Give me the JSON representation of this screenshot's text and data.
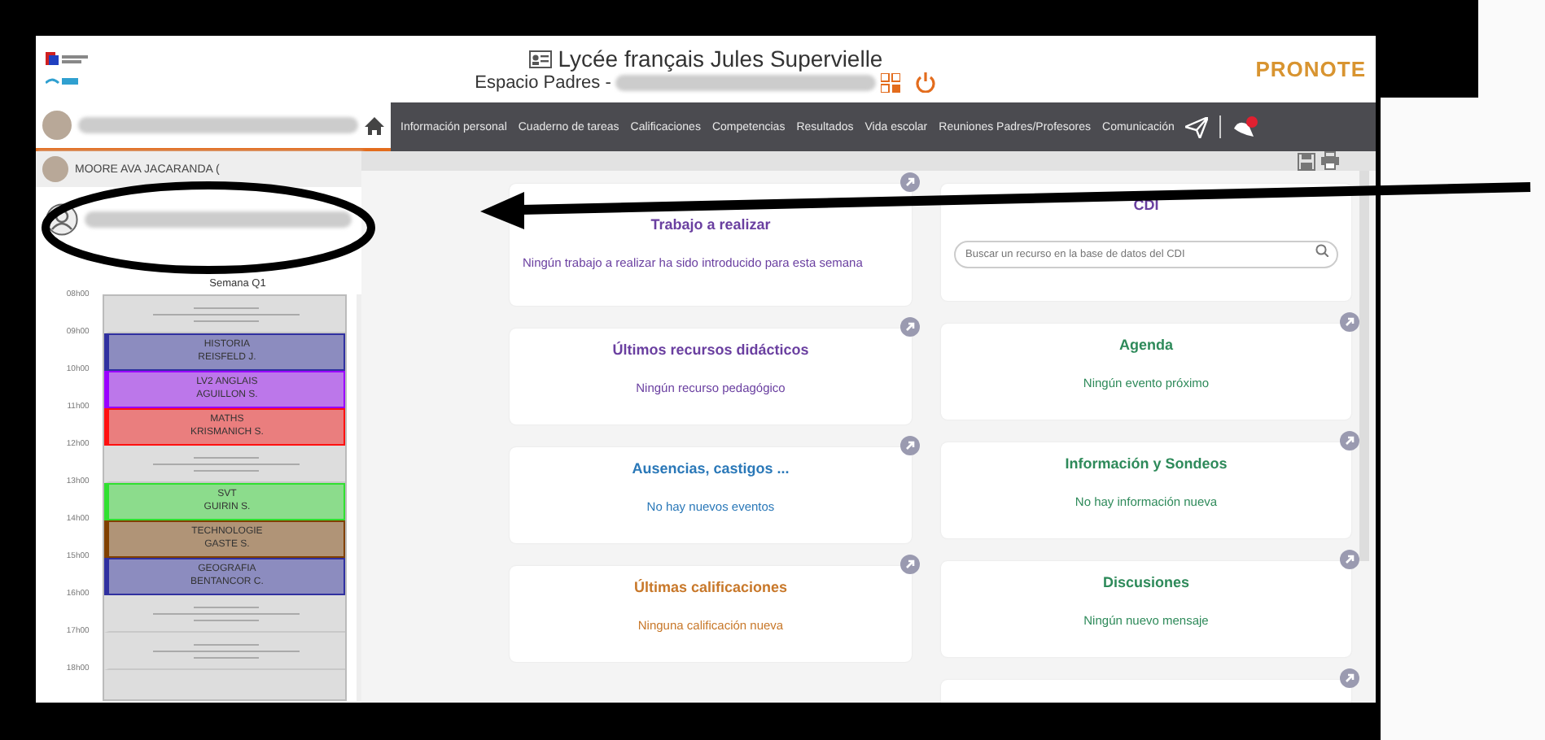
{
  "header": {
    "title": "Lycée français Jules Supervielle",
    "subtitle": "Espacio Padres -",
    "logo": "PRONOTE"
  },
  "nav": {
    "items": [
      {
        "label": "Información personal"
      },
      {
        "label": "Cuaderno de tareas"
      },
      {
        "label": "Calificaciones"
      },
      {
        "label": "Competencias"
      },
      {
        "label": "Resultados"
      },
      {
        "label": "Vida escolar"
      },
      {
        "label": "Reuniones Padres/Profesores"
      },
      {
        "label": "Comunicación"
      }
    ]
  },
  "sidebar": {
    "student": "MOORE AVA JACARANDA (",
    "week": "Semana Q1",
    "hours": [
      "08h00",
      "09h00",
      "10h00",
      "11h00",
      "12h00",
      "13h00",
      "14h00",
      "15h00",
      "16h00",
      "17h00",
      "18h00"
    ],
    "slots": [
      {
        "kind": "empty"
      },
      {
        "kind": "lesson",
        "subject": "HISTORIA",
        "teacher": "REISFELD J.",
        "color": "#3030a0"
      },
      {
        "kind": "lesson",
        "subject": "LV2 ANGLAIS",
        "teacher": "AGUILLON S.",
        "color": "#9a00ff"
      },
      {
        "kind": "lesson",
        "subject": "MATHS",
        "teacher": "KRISMANICH S.",
        "color": "#ff1010"
      },
      {
        "kind": "empty"
      },
      {
        "kind": "lesson",
        "subject": "SVT",
        "teacher": "GUIRIN S.",
        "color": "#30e030"
      },
      {
        "kind": "lesson",
        "subject": "TECHNOLOGIE",
        "teacher": "GASTE S.",
        "color": "#804000"
      },
      {
        "kind": "lesson",
        "subject": "GEOGRAFIA",
        "teacher": "BENTANCOR C.",
        "color": "#3030a0"
      },
      {
        "kind": "empty"
      },
      {
        "kind": "empty"
      }
    ]
  },
  "columns": [
    {
      "cards": [
        {
          "kind": "message",
          "title": "Trabajo a realizar",
          "message": "Ningún trabajo a realizar ha sido introducido para esta semana",
          "color": "#6a3fa0"
        },
        {
          "kind": "message",
          "title": "Últimos recursos didácticos",
          "message": "Ningún recurso pedagógico",
          "color": "#6a3fa0"
        },
        {
          "kind": "message",
          "title": "Ausencias, castigos ...",
          "message": "No hay nuevos eventos",
          "color": "#2a78b8"
        },
        {
          "kind": "message",
          "title": "Últimas calificaciones",
          "message": "Ninguna calificación nueva",
          "color": "#c8782a"
        }
      ]
    },
    {
      "cards": [
        {
          "kind": "search",
          "title": "CDI",
          "placeholder": "Buscar un recurso en la base de datos del CDI",
          "color": "#6a3fa0"
        },
        {
          "kind": "message",
          "title": "Agenda",
          "message": "Ningún evento próximo",
          "color": "#2e8a5a"
        },
        {
          "kind": "message",
          "title": "Información y Sondeos",
          "message": "No hay información nueva",
          "color": "#2e8a5a"
        },
        {
          "kind": "message",
          "title": "Discusiones",
          "message": "Ningún nuevo mensaje",
          "color": "#2e8a5a"
        },
        {
          "kind": "blank"
        }
      ]
    }
  ]
}
